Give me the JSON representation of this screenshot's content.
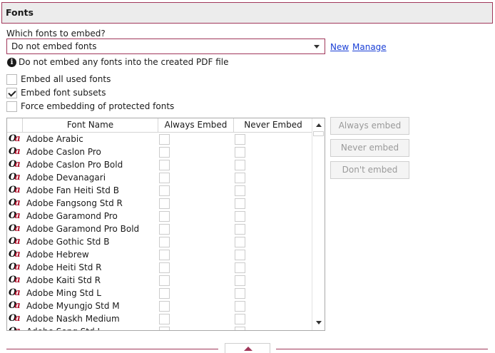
{
  "section": {
    "title": "Fonts"
  },
  "embed_select": {
    "label": "Which fonts to embed?",
    "value": "Do not embed fonts",
    "new_link": "New",
    "manage_link": "Manage"
  },
  "info_text": "Do not embed any fonts into the created PDF file",
  "options": {
    "embed_all": {
      "label": "Embed all used fonts",
      "checked": false
    },
    "embed_subsets": {
      "label": "Embed font subsets",
      "checked": true
    },
    "force_protected": {
      "label": "Force embedding of protected fonts",
      "checked": false
    }
  },
  "grid": {
    "columns": {
      "name": "Font Name",
      "always": "Always Embed",
      "never": "Never Embed"
    },
    "fonts": [
      "Adobe Arabic",
      "Adobe Caslon Pro",
      "Adobe Caslon Pro Bold",
      "Adobe Devanagari",
      "Adobe Fan Heiti Std B",
      "Adobe Fangsong Std R",
      "Adobe Garamond Pro",
      "Adobe Garamond Pro Bold",
      "Adobe Gothic Std B",
      "Adobe Hebrew",
      "Adobe Heiti Std R",
      "Adobe Kaiti Std R",
      "Adobe Ming Std L",
      "Adobe Myungjo Std M",
      "Adobe Naskh Medium",
      "Adobe Song Std L"
    ],
    "font_icon": "opentype-font-icon"
  },
  "buttons": {
    "always_embed": "Always embed",
    "never_embed": "Never embed",
    "dont_embed": "Don't embed"
  },
  "colors": {
    "accent": "#a0375a",
    "link": "#1a3fd6",
    "disabled_text": "#9a9a9a"
  }
}
